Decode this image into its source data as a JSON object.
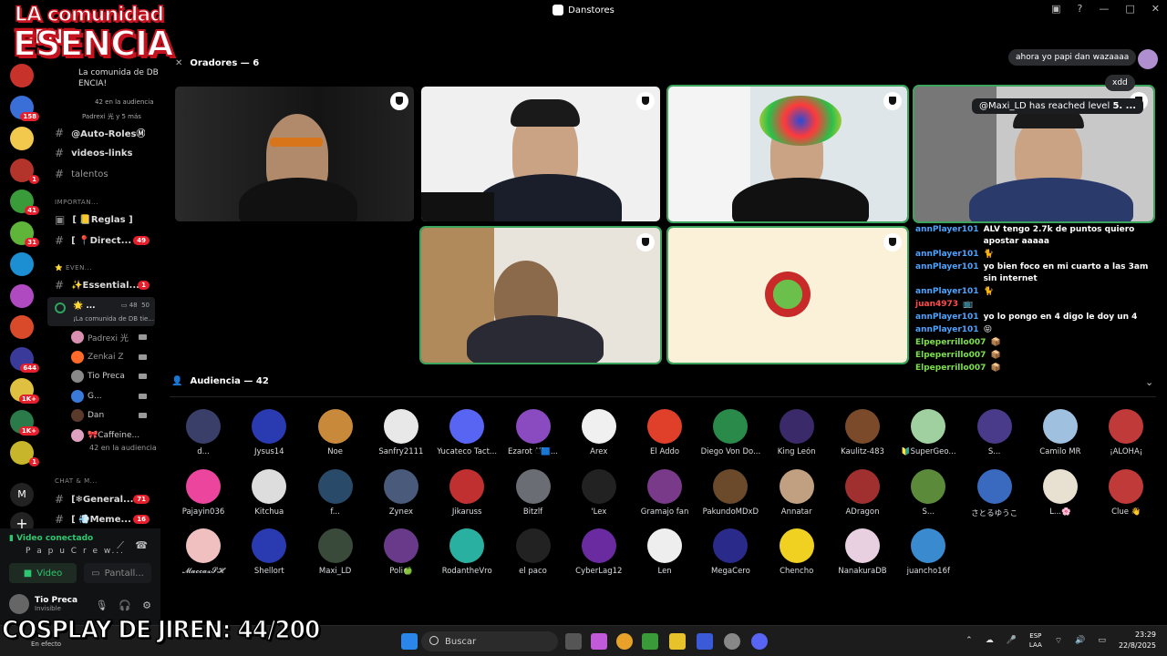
{
  "window": {
    "title": "Danstores"
  },
  "overlay": {
    "line1": "LA comunidad TIENE",
    "line2": "ESENCIA",
    "caption": "COSPLAY DE JIREN: 44/200"
  },
  "sidebar_header": {
    "line1": "La comunida de DB",
    "line2": "ENCIA!",
    "line3": "42 en la audiencia",
    "line4": "Padrexi 光 y 5 más"
  },
  "servers": [
    {
      "badge": "",
      "color": "#c7332b"
    },
    {
      "badge": "158",
      "color": "#3a6fd8"
    },
    {
      "badge": "",
      "color": "#f2c94c"
    },
    {
      "badge": "1",
      "color": "#b2342a"
    },
    {
      "badge": "41",
      "color": "#3a9b3a"
    },
    {
      "badge": "31",
      "color": "#5fb43a"
    },
    {
      "badge": "",
      "color": "#1b8fd1"
    },
    {
      "badge": "",
      "color": "#b04ac0"
    },
    {
      "badge": "",
      "color": "#d84a2a"
    },
    {
      "badge": "644",
      "color": "#3a3a9b"
    },
    {
      "badge": "1K+",
      "color": "#e0c040"
    },
    {
      "badge": "1K+",
      "color": "#2a7a4a"
    },
    {
      "badge": "1",
      "color": "#c7b52b"
    }
  ],
  "server_letter": "M",
  "channels": {
    "c1": "@Auto-RolesⓂ",
    "c2": "videos-links",
    "c3": "talentos",
    "cat1": "IMPORTAN...",
    "c4": "[ 📒Reglas ]",
    "c5": "[ 📍Direct...",
    "c5_badge": "49",
    "cat2": "⭐ EVEN...",
    "c6": "✨Essential...",
    "c6_badge": "1",
    "vc_name": "🌟 ...",
    "vc_count_cam": "48",
    "vc_count": "50",
    "vc_sub": "¡La comunida de DB tie...",
    "cat3": "CHAT & M...",
    "c7": "[❄General...",
    "c7_badge": "71",
    "c8": "[ 💨Meme...",
    "c8_badge": "16"
  },
  "voice_members": [
    {
      "name": "Padrexi 光",
      "color": "#d88fb0"
    },
    {
      "name": "Zenkai Z",
      "color": "#ff6a2a"
    },
    {
      "name": "Tio Preca",
      "color": "#888"
    },
    {
      "name": "G...",
      "color": "#3a7ad8"
    },
    {
      "name": "Dan",
      "color": "#5a3a2a"
    },
    {
      "name": "🎀Caffeine...",
      "color": "#e0a0c0"
    }
  ],
  "voice_audience": "42 en la audiencia",
  "user_panel": {
    "status": "Video conectado",
    "channel": "P a p u  C r e w...",
    "video_btn": "Video",
    "screen_btn": "Pantall...",
    "name": "Tio Preca",
    "presence": "Invisible"
  },
  "stage": {
    "speakers_header": "Oradores — 6",
    "audience_header": "Audiencia — 42"
  },
  "chat": {
    "bubble1": "ahora yo papi dan wazaaaa",
    "bubble2": "xdd",
    "level_user": "@Maxi_LD",
    "level_text": "has reached level",
    "level_value": "5. ...",
    "messages": [
      {
        "user": "annPlayer101",
        "cls": "",
        "text": "ALV tengo 2.7k de puntos quiero apostar aaaaa"
      },
      {
        "user": "annPlayer101",
        "cls": "",
        "text": "🐈"
      },
      {
        "user": "annPlayer101",
        "cls": "",
        "text": "yo bien foco en mi cuarto a las 3am sin internet"
      },
      {
        "user": "annPlayer101",
        "cls": "",
        "text": "🐈"
      },
      {
        "user": "juan4973",
        "cls": "r",
        "text": "📺"
      },
      {
        "user": "annPlayer101",
        "cls": "",
        "text": "yo lo pongo en 4 digo le doy un 4"
      },
      {
        "user": "annPlayer101",
        "cls": "",
        "text": "😝"
      },
      {
        "user": "Elpeperrillo007",
        "cls": "g",
        "text": "📦"
      },
      {
        "user": "Elpeperrillo007",
        "cls": "g",
        "text": "📦"
      },
      {
        "user": "Elpeperrillo007",
        "cls": "g",
        "text": "📦"
      }
    ]
  },
  "audience": [
    {
      "name": "d...",
      "color": "#3a3f6a"
    },
    {
      "name": "Jysus14",
      "color": "#2a3ab0"
    },
    {
      "name": "Noe",
      "color": "#c88a3a"
    },
    {
      "name": "Sanfry2111",
      "color": "#e8e8e8"
    },
    {
      "name": "Yucateco Tact...",
      "color": "#5865f2"
    },
    {
      "name": "Ezarot ි🟦...",
      "color": "#8a4ac0"
    },
    {
      "name": "Arex",
      "color": "#f0f0f0"
    },
    {
      "name": "El Addo",
      "color": "#e0402a"
    },
    {
      "name": "Diego Von Do...",
      "color": "#2a8a4a"
    },
    {
      "name": "King León",
      "color": "#3a2a6a"
    },
    {
      "name": "Kaulitz-483",
      "color": "#7a4a2a"
    },
    {
      "name": "🔰SuperGeo...",
      "color": "#a0d0a0"
    },
    {
      "name": "S...",
      "color": "#4a3a8a"
    },
    {
      "name": "Camilo MR",
      "color": "#a0c0e0"
    },
    {
      "name": "¡ALOHA¡",
      "color": "#c03a3a"
    },
    {
      "name": "Pajayin036",
      "color": "#eb459e"
    },
    {
      "name": "Kitchua",
      "color": "#ddd"
    },
    {
      "name": "f...",
      "color": "#2a4a6a"
    },
    {
      "name": "Zynex",
      "color": "#4a5a7a"
    },
    {
      "name": "Jikaruss",
      "color": "#c03030"
    },
    {
      "name": "Bitzlf",
      "color": "#6a6d73"
    },
    {
      "name": "'Lex",
      "color": "#222"
    },
    {
      "name": "Gramajo fan",
      "color": "#7a3a8a"
    },
    {
      "name": "PakundoMDxD",
      "color": "#6a4a2a"
    },
    {
      "name": "Annatar",
      "color": "#c0a080"
    },
    {
      "name": "ADragon",
      "color": "#a03030"
    },
    {
      "name": "S...",
      "color": "#5a8a3a"
    },
    {
      "name": "さとるゆうこ",
      "color": "#3a6ac0"
    },
    {
      "name": "L...🌸",
      "color": "#e8e0d0"
    },
    {
      "name": "Clue 👋",
      "color": "#c03a3a"
    },
    {
      "name": "𝓜𝓪𝓬𝓬𝓪𝔁𝓢𝓗",
      "color": "#f0c0c0"
    },
    {
      "name": "Shellort",
      "color": "#2a3ab0"
    },
    {
      "name": "Maxi_LD",
      "color": "#3a4a3a"
    },
    {
      "name": "Poli🍏",
      "color": "#6a3a8a"
    },
    {
      "name": "RodantheVro",
      "color": "#2ab0a0"
    },
    {
      "name": "el paco",
      "color": "#222"
    },
    {
      "name": "CyberLag12",
      "color": "#6a2aa0"
    },
    {
      "name": "Len",
      "color": "#eee"
    },
    {
      "name": "MegaCero",
      "color": "#2a2a8a"
    },
    {
      "name": "Chencho",
      "color": "#f0d020"
    },
    {
      "name": "NanakuraDB",
      "color": "#e8d0e0"
    },
    {
      "name": "juancho16f",
      "color": "#3a8ad0"
    }
  ],
  "taskbar": {
    "search": "Buscar",
    "weather": "En efecto",
    "lang1": "ESP",
    "lang2": "LAA",
    "time": "23:29",
    "date": "22/8/2025"
  }
}
